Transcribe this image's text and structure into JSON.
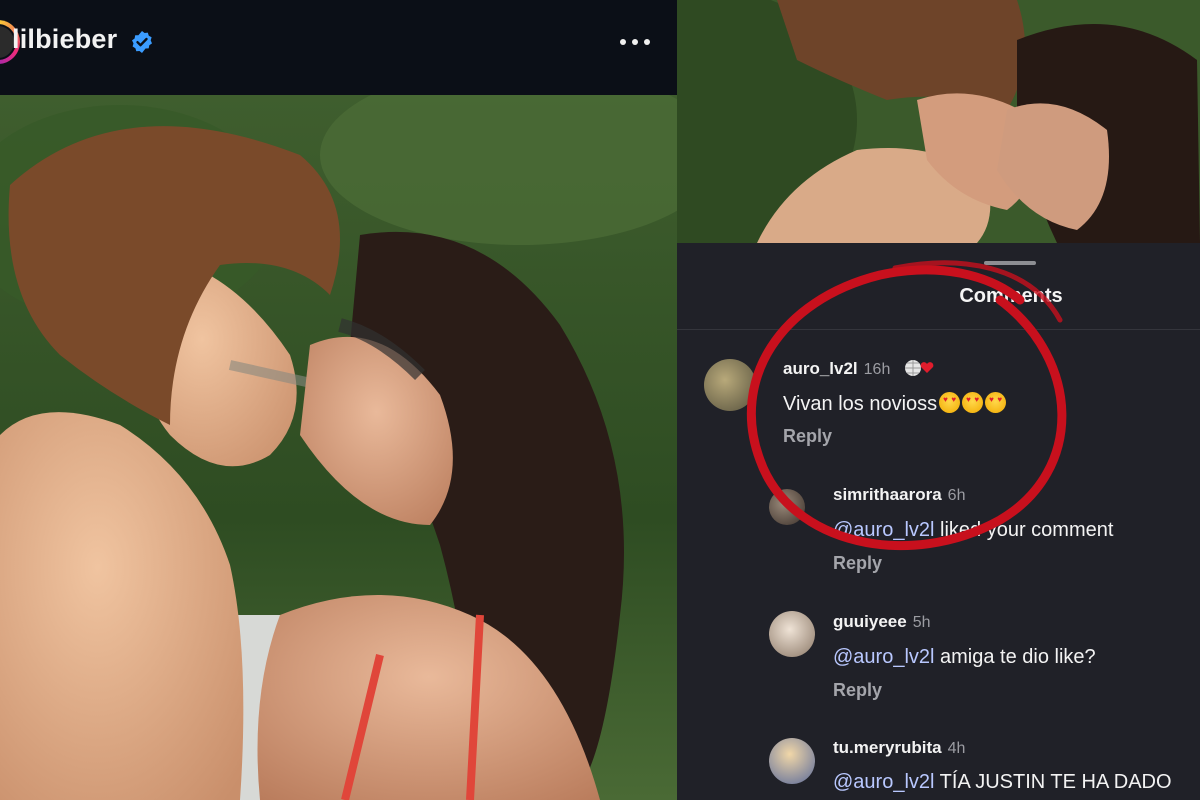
{
  "post": {
    "username": "lilbieber",
    "verified_icon": "verified-badge-icon",
    "more_icon": "more-options-icon"
  },
  "comments_sheet": {
    "title": "Comments",
    "reply_label": "Reply",
    "comments": [
      {
        "user": "auro_lv2l",
        "time": "16h",
        "text": "Vivan los novioss",
        "emoji_count": 3
      },
      {
        "user": "simrithaarora",
        "time": "6h",
        "mention": "@auro_lv2l",
        "text": " liked your comment"
      },
      {
        "user": "guuiyeee",
        "time": "5h",
        "mention": "@auro_lv2l",
        "text": " amiga te dio like?"
      },
      {
        "user": "tu.meryrubita",
        "time": "4h",
        "mention": "@auro_lv2l",
        "text": " TÍA JUSTIN TE HA DADO"
      }
    ]
  },
  "colors": {
    "accent_red": "#c8101d",
    "mention_blue": "#b9c8ff",
    "sheet_bg": "#202128",
    "verified_blue": "#3b9cff"
  }
}
